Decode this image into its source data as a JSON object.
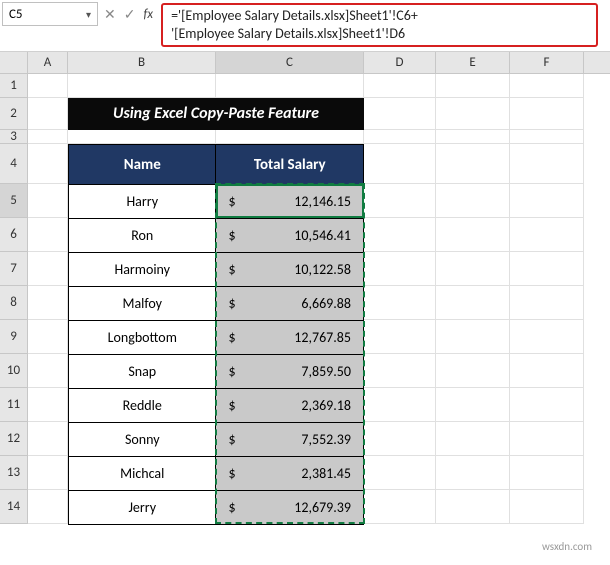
{
  "name_box": "C5",
  "formula_line1": "='[Employee Salary Details.xlsx]Sheet1'!C6+",
  "formula_line2": "'[Employee Salary Details.xlsx]Sheet1'!D6",
  "columns": {
    "A": "A",
    "B": "B",
    "C": "C",
    "D": "D",
    "E": "E",
    "F": "F"
  },
  "row_labels": [
    "1",
    "2",
    "3",
    "4",
    "5",
    "6",
    "7",
    "8",
    "9",
    "10",
    "11",
    "12",
    "13",
    "14"
  ],
  "title": "Using Excel Copy-Paste Feature",
  "headers": {
    "name": "Name",
    "salary": "Total Salary"
  },
  "currency": "$",
  "rows": [
    {
      "name": "Harry",
      "salary": "12,146.15"
    },
    {
      "name": "Ron",
      "salary": "10,546.41"
    },
    {
      "name": "Harmoiny",
      "salary": "10,122.58"
    },
    {
      "name": "Malfoy",
      "salary": "6,669.88"
    },
    {
      "name": "Longbottom",
      "salary": "12,767.85"
    },
    {
      "name": "Snap",
      "salary": "7,859.50"
    },
    {
      "name": "Reddle",
      "salary": "2,369.18"
    },
    {
      "name": "Sonny",
      "salary": "7,552.39"
    },
    {
      "name": "Michcal",
      "salary": "2,381.45"
    },
    {
      "name": "Jerry",
      "salary": "12,679.39"
    }
  ],
  "watermark": "wsxdn.com",
  "icons": {
    "dropdown": "▾",
    "cancel": "✕",
    "confirm": "✓",
    "fx": "fx"
  }
}
